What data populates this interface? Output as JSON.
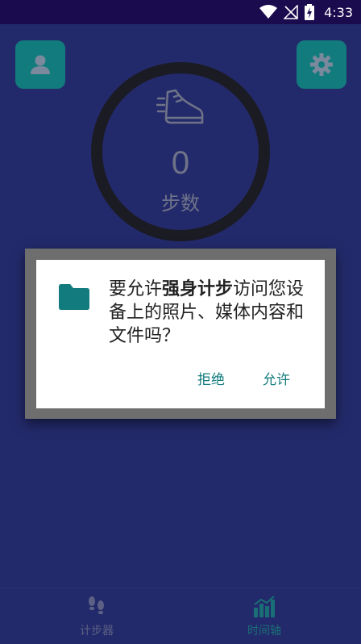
{
  "status_bar": {
    "time": "4:33",
    "icons": [
      "wifi-icon",
      "no-signal-icon",
      "battery-charging-icon"
    ]
  },
  "header": {
    "profile_icon": "person-icon",
    "settings_icon": "gear-icon"
  },
  "pedometer": {
    "count": "0",
    "label": "步数",
    "icon": "shoe-icon"
  },
  "dialog": {
    "message_prefix": "要允许",
    "app_name": "强身计步",
    "message_suffix": "访问您设备上的照片、媒体内容和文件吗？",
    "deny_label": "拒绝",
    "allow_label": "允许",
    "accent_color": "#127b7d",
    "icon": "folder-icon"
  },
  "bottom_nav": {
    "items": [
      {
        "label": "计步器",
        "icon": "footsteps-icon"
      },
      {
        "label": "时间轴",
        "icon": "bar-chart-icon"
      }
    ]
  }
}
